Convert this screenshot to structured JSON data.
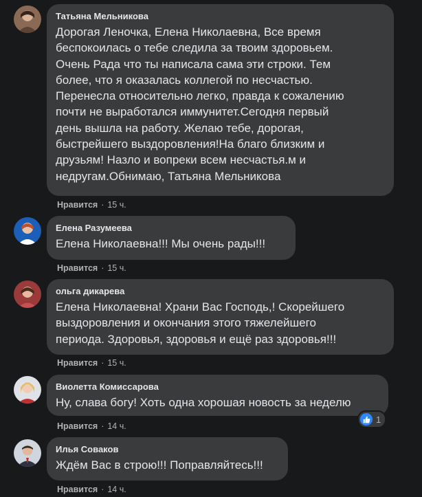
{
  "comments": [
    {
      "author": "Татьяна Мельникова",
      "text": "Дорогая Леночка, Елена Николаевна, Все время\nбеспокоилась о тебе следила за твоим здоровьем.\nОчень Рада что ты написала сама эти строки. Тем\nболее, что я оказалась коллегой по несчастью.\nПеренесла относительно легко, правда к сожалению\nпочти не выработался иммунитет.Сегодня первый\nдень вышла на работу. Желаю тебе, дорогая,\nбыстрейшего выздоровления!На благо близким и\nдрузьям! Назло и вопреки всем несчастья.м и\nнедругам.Обнимаю, Татьяна Мельникова",
      "like_label": "Нравится",
      "separator": "·",
      "time": "15 ч."
    },
    {
      "author": "Елена Разумеева",
      "text": "Елена Николаевна!!! Мы очень рады!!!",
      "like_label": "Нравится",
      "separator": "·",
      "time": "15 ч."
    },
    {
      "author": "ольга дикарева",
      "text": "Елена Николаевна! Храни Вас Господь,! Скорейшего\nвыздоровления и окончания этого тяжелейшего\nпериода. Здоровья, здоровья и ещё раз здоровья!!!",
      "like_label": "Нравится",
      "separator": "·",
      "time": "15 ч."
    },
    {
      "author": "Виолетта Комиссарова",
      "text": "Ну, слава богу! Хоть одна хорошая новость за неделю",
      "like_label": "Нравится",
      "separator": "·",
      "time": "14 ч.",
      "reactions": {
        "icon": "like-icon",
        "count": "1"
      }
    },
    {
      "author": "Илья Соваков",
      "text": "Ждём Вас в строю!!! Поправляйтесь!!!",
      "like_label": "Нравится",
      "separator": "·",
      "time": "14 ч."
    }
  ],
  "colors": {
    "background": "#18191a",
    "bubble": "#3a3b3c",
    "text": "#e4e6eb",
    "meta": "#b0b3b8",
    "like_badge": "#2d88ff"
  }
}
